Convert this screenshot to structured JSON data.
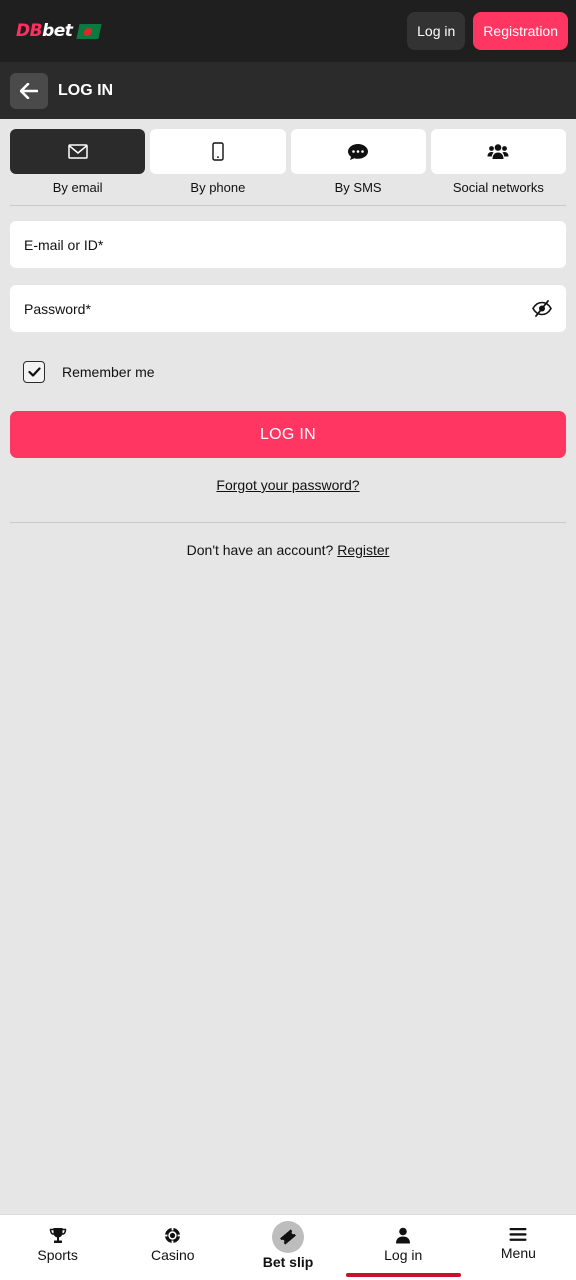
{
  "header": {
    "logo_part1": "DB",
    "logo_part2": "bet",
    "login_label": "Log in",
    "registration_label": "Registration"
  },
  "subheader": {
    "title": "LOG IN"
  },
  "tabs": [
    {
      "label": "By email",
      "icon": "envelope-icon",
      "active": true
    },
    {
      "label": "By phone",
      "icon": "phone-icon",
      "active": false
    },
    {
      "label": "By SMS",
      "icon": "chat-icon",
      "active": false
    },
    {
      "label": "Social networks",
      "icon": "users-icon",
      "active": false
    }
  ],
  "form": {
    "email_placeholder": "E-mail or ID*",
    "password_placeholder": "Password*",
    "remember_label": "Remember me",
    "remember_checked": true,
    "login_button": "LOG IN",
    "forgot_link": "Forgot your password?",
    "no_account_text": "Don't have an account?",
    "register_link": "Register"
  },
  "bottom_nav": [
    {
      "label": "Sports",
      "icon": "trophy-icon"
    },
    {
      "label": "Casino",
      "icon": "casino-chip-icon"
    },
    {
      "label": "Bet slip",
      "icon": "ticket-icon"
    },
    {
      "label": "Log in",
      "icon": "user-icon",
      "active": true
    },
    {
      "label": "Menu",
      "icon": "menu-icon"
    }
  ],
  "colors": {
    "accent": "#ff3562",
    "dark": "#1f1f1f",
    "active_indicator": "#c8102e"
  }
}
